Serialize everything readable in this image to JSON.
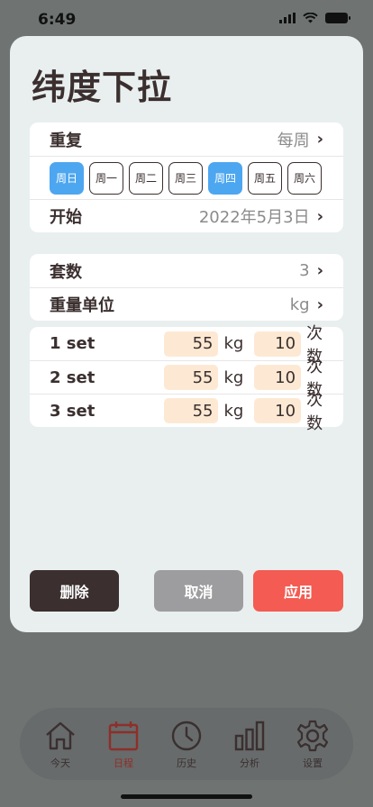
{
  "status": {
    "time": "6:49"
  },
  "sheet": {
    "title": "纬度下拉",
    "repeat": {
      "label": "重复",
      "value": "每周"
    },
    "days": [
      {
        "label": "周日",
        "active": true
      },
      {
        "label": "周一",
        "active": false
      },
      {
        "label": "周二",
        "active": false
      },
      {
        "label": "周三",
        "active": false
      },
      {
        "label": "周四",
        "active": true
      },
      {
        "label": "周五",
        "active": false
      },
      {
        "label": "周六",
        "active": false
      }
    ],
    "start": {
      "label": "开始",
      "value": "2022年5月3日"
    },
    "sets_count": {
      "label": "套数",
      "value": "3"
    },
    "weight_unit": {
      "label": "重量单位",
      "value": "kg"
    },
    "sets": [
      {
        "label": "1 set",
        "weight": "55",
        "weight_unit": "kg",
        "reps": "10",
        "reps_unit": "次数"
      },
      {
        "label": "2 set",
        "weight": "55",
        "weight_unit": "kg",
        "reps": "10",
        "reps_unit": "次数"
      },
      {
        "label": "3 set",
        "weight": "55",
        "weight_unit": "kg",
        "reps": "10",
        "reps_unit": "次数"
      }
    ],
    "buttons": {
      "delete": "删除",
      "cancel": "取消",
      "apply": "应用"
    }
  },
  "tabbar": {
    "items": [
      {
        "label": "今天",
        "icon": "home-icon"
      },
      {
        "label": "日程",
        "icon": "calendar-icon",
        "active": true
      },
      {
        "label": "历史",
        "icon": "clock-icon"
      },
      {
        "label": "分析",
        "icon": "bar-chart-icon"
      },
      {
        "label": "设置",
        "icon": "gear-icon"
      }
    ]
  },
  "colors": {
    "accent_blue": "#4da6f0",
    "apply_red": "#f45b52",
    "delete_dark": "#3b2f2f",
    "cancel_gray": "#9d9d9f",
    "input_fill": "#fde9d3",
    "active_tab": "#8e2f2a"
  }
}
